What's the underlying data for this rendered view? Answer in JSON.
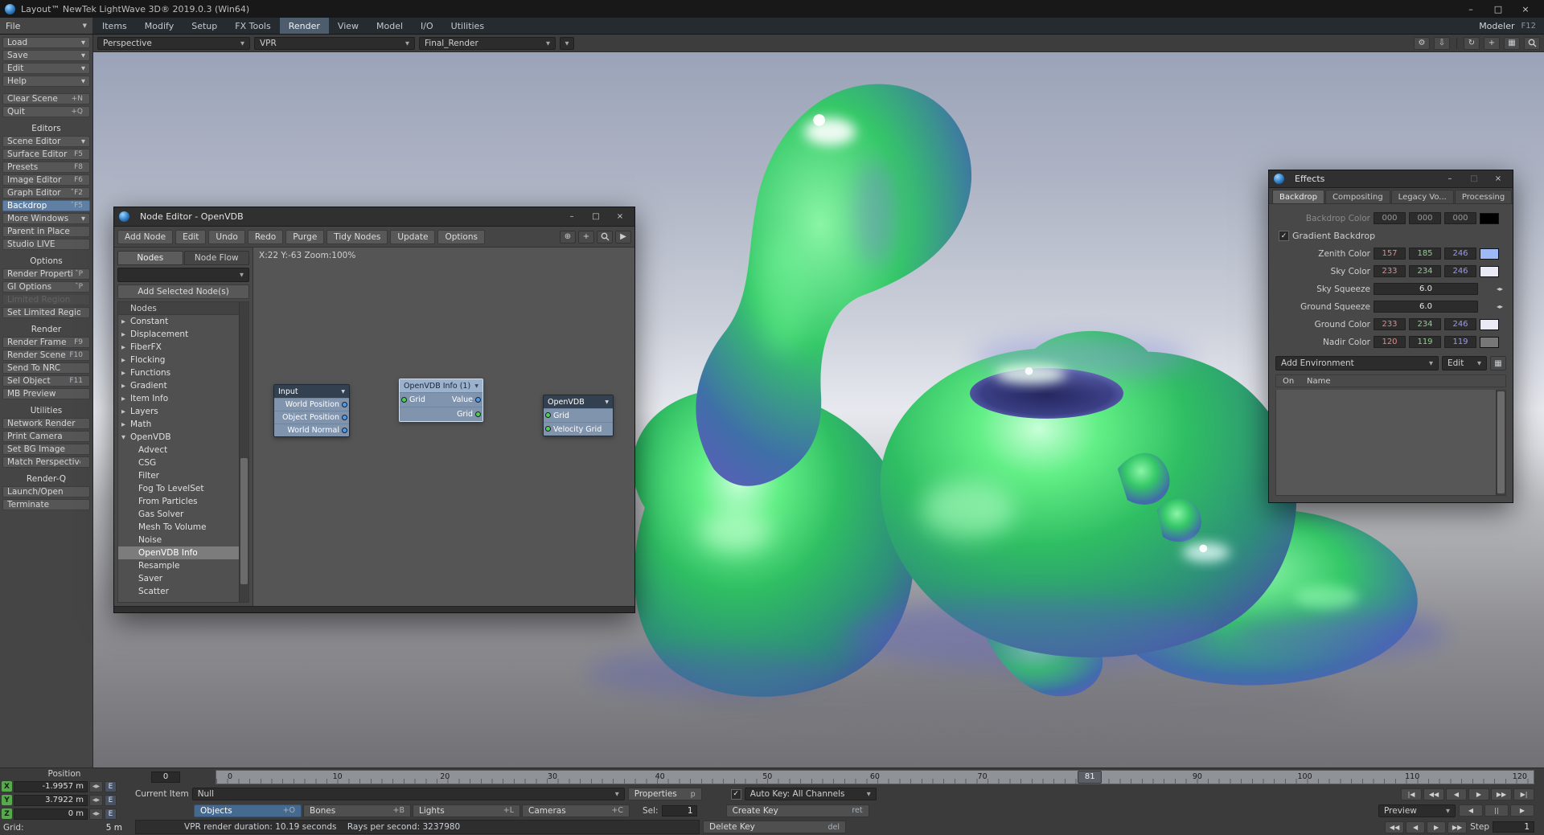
{
  "icons": {
    "chevron_down": "▼",
    "minimize": "–",
    "maximize": "□",
    "close": "×",
    "gear": "⚙",
    "download": "⇩",
    "rotate": "↻",
    "pan": "+",
    "grid": "▦",
    "pick": "⊕",
    "play": "▶",
    "check": "✓",
    "spinner": "◀▶",
    "stepper": "◂▸"
  },
  "titlebar": {
    "title": "Layout™ NewTek LightWave 3D® 2019.0.3 (Win64)"
  },
  "menubar": {
    "file": "File",
    "tabs": [
      {
        "label": "Items"
      },
      {
        "label": "Modify"
      },
      {
        "label": "Setup"
      },
      {
        "label": "FX Tools"
      },
      {
        "label": "Render",
        "state": "active"
      },
      {
        "label": "View"
      },
      {
        "label": "Model"
      },
      {
        "label": "I/O"
      },
      {
        "label": "Utilities"
      }
    ],
    "modeler": "Modeler",
    "modeler_key": "F12"
  },
  "viewport_bar": {
    "view": "Perspective",
    "renderer": "VPR",
    "camera": "Final_Render"
  },
  "sidebar": {
    "file_group": [
      {
        "label": "Load",
        "chev": "▼"
      },
      {
        "label": "Save",
        "chev": "▼"
      },
      {
        "label": "Edit",
        "chev": "▼"
      },
      {
        "label": "Help",
        "chev": "▼"
      }
    ],
    "scene_group": [
      {
        "label": "Clear Scene",
        "key": "+N"
      },
      {
        "label": "Quit",
        "key": "+Q"
      }
    ],
    "editors_title": "Editors",
    "editors_group": [
      {
        "label": "Scene Editor",
        "chev": "▼"
      },
      {
        "label": "Surface Editor",
        "key": "F5"
      },
      {
        "label": "Presets",
        "key": "F8"
      },
      {
        "label": "Image Editor",
        "key": "F6"
      },
      {
        "label": "Graph Editor",
        "key": "ˆF2"
      },
      {
        "label": "Backdrop",
        "key": "ˆF5",
        "state": "active"
      },
      {
        "label": "More Windows",
        "chev": "▼"
      },
      {
        "label": "Parent in Place"
      },
      {
        "label": "Studio LIVE"
      }
    ],
    "options_title": "Options",
    "options_group": [
      {
        "label": "Render Properties",
        "key": "ˆP"
      },
      {
        "label": "GI Options",
        "key": "ˆP"
      },
      {
        "label": "Limited Region",
        "state": "dim"
      },
      {
        "label": "Set Limited Region"
      }
    ],
    "render_title": "Render",
    "render_group": [
      {
        "label": "Render Frame",
        "key": "F9"
      },
      {
        "label": "Render Scene",
        "key": "F10"
      },
      {
        "label": "Send To NRC"
      },
      {
        "label": "Sel Object",
        "key": "F11"
      },
      {
        "label": "MB Preview"
      }
    ],
    "utilities_title": "Utilities",
    "utilities_group": [
      {
        "label": "Network Render"
      },
      {
        "label": "Print Camera"
      },
      {
        "label": "Set BG Image"
      },
      {
        "label": "Match Perspective"
      }
    ],
    "renderq_title": "Render-Q",
    "renderq_group": [
      {
        "label": "Launch/Open"
      },
      {
        "label": "Terminate"
      }
    ]
  },
  "node_editor": {
    "title": "Node Editor - OpenVDB",
    "toolbar": [
      {
        "label": "Add Node"
      },
      {
        "label": "Edit"
      },
      {
        "label": "Undo"
      },
      {
        "label": "Redo"
      },
      {
        "label": "Purge"
      },
      {
        "label": "Tidy Nodes"
      },
      {
        "label": "Update"
      },
      {
        "label": "Options"
      }
    ],
    "tabs": [
      {
        "label": "Nodes",
        "state": "active"
      },
      {
        "label": "Node Flow"
      }
    ],
    "add_selected": "Add Selected Node(s)",
    "list": [
      {
        "label": "Nodes",
        "state": "header"
      },
      {
        "label": "Constant",
        "arrow": "▶"
      },
      {
        "label": "Displacement",
        "arrow": "▶"
      },
      {
        "label": "FiberFX",
        "arrow": "▶"
      },
      {
        "label": "Flocking",
        "arrow": "▶"
      },
      {
        "label": "Functions",
        "arrow": "▶"
      },
      {
        "label": "Gradient",
        "arrow": "▶"
      },
      {
        "label": "Item Info",
        "arrow": "▶"
      },
      {
        "label": "Layers",
        "arrow": "▶"
      },
      {
        "label": "Math",
        "arrow": "▶"
      },
      {
        "label": "OpenVDB",
        "arrow": "▼"
      },
      {
        "label": "Advect",
        "child": "1"
      },
      {
        "label": "CSG",
        "child": "1"
      },
      {
        "label": "Filter",
        "child": "1"
      },
      {
        "label": "Fog To LevelSet",
        "child": "1"
      },
      {
        "label": "From Particles",
        "child": "1"
      },
      {
        "label": "Gas Solver",
        "child": "1"
      },
      {
        "label": "Mesh To Volume",
        "child": "1"
      },
      {
        "label": "Noise",
        "child": "1"
      },
      {
        "label": "OpenVDB Info",
        "child": "1",
        "state": "active"
      },
      {
        "label": "Resample",
        "child": "1"
      },
      {
        "label": "Saver",
        "child": "1"
      },
      {
        "label": "Scatter",
        "child": "1"
      }
    ],
    "graph": {
      "coords": "X:22 Y:-63 Zoom:100%",
      "input_node": {
        "title": "Input",
        "rows": [
          {
            "label": "World Position"
          },
          {
            "label": "Object Position"
          },
          {
            "label": "World Normal"
          }
        ]
      },
      "info_node": {
        "title": "OpenVDB Info (1)",
        "input": "Grid",
        "out_value": "Value",
        "out_grid": "Grid"
      },
      "vdb_node": {
        "title": "OpenVDB",
        "rows": [
          {
            "label": "Grid"
          },
          {
            "label": "Velocity Grid"
          }
        ]
      }
    }
  },
  "effects": {
    "title": "Effects",
    "tabs": [
      {
        "label": "Backdrop",
        "state": "active"
      },
      {
        "label": "Compositing"
      },
      {
        "label": "Legacy Vo..."
      },
      {
        "label": "Processing"
      }
    ],
    "rows": {
      "backdrop": {
        "label": "Backdrop Color",
        "r": "000",
        "g": "000",
        "b": "000",
        "swatch": "#000000"
      },
      "gradient": {
        "label": "Gradient Backdrop"
      },
      "zenith": {
        "label": "Zenith Color",
        "r": "157",
        "g": "185",
        "b": "246",
        "swatch": "#9db9f6"
      },
      "sky": {
        "label": "Sky Color",
        "r": "233",
        "g": "234",
        "b": "246",
        "swatch": "#e9eaf6"
      },
      "sky_squeeze": {
        "label": "Sky Squeeze",
        "value": "6.0"
      },
      "ground_squeeze": {
        "label": "Ground Squeeze",
        "value": "6.0"
      },
      "ground": {
        "label": "Ground Color",
        "r": "233",
        "g": "234",
        "b": "246",
        "swatch": "#e9eaf6"
      },
      "nadir": {
        "label": "Nadir Color",
        "r": "120",
        "g": "119",
        "b": "119",
        "swatch": "#787777"
      }
    },
    "add_environment": "Add Environment",
    "edit": "Edit",
    "list_on": "On",
    "list_name": "Name"
  },
  "viewport": {
    "sky_top": "#9aa3b8",
    "horizon": "#e7e9ef",
    "ground_bottom": "#717175"
  },
  "timeline": {
    "start": "0",
    "slots": [
      {
        "t": "0"
      },
      {
        "t": "10"
      },
      {
        "t": "20"
      },
      {
        "t": "30"
      },
      {
        "t": "40"
      },
      {
        "t": "50"
      },
      {
        "t": "60"
      },
      {
        "t": "70"
      },
      {
        "t": "81",
        "state": "handle"
      },
      {
        "t": "90"
      },
      {
        "t": "100"
      },
      {
        "t": "110"
      },
      {
        "t": "120"
      }
    ]
  },
  "bottom": {
    "position_label": "Position",
    "axes": [
      {
        "axis": "X",
        "value": "-1.9957 m"
      },
      {
        "axis": "Y",
        "value": "3.7922 m"
      },
      {
        "axis": "Z",
        "value": "0 m"
      }
    ],
    "envelope": "E",
    "grid_label": "Grid:",
    "grid_value": "5 m",
    "current_item_label": "Current Item",
    "current_item": "Null",
    "properties_label": "Properties",
    "properties_key": "p",
    "autokey_label": "Auto Key: All Channels",
    "item_types": [
      {
        "label": "Objects",
        "key": "+O",
        "state": "active"
      },
      {
        "label": "Bones",
        "key": "+B"
      },
      {
        "label": "Lights",
        "key": "+L"
      },
      {
        "label": "Cameras",
        "key": "+C"
      }
    ],
    "sel_label": "Sel:",
    "sel_value": "1",
    "create_key": {
      "label": "Create Key",
      "key": "ret"
    },
    "delete_key": {
      "label": "Delete Key",
      "key": "del"
    },
    "status": "VPR render duration: 10.19 seconds    Rays per second: 3237980",
    "transport_a": [
      "|◀",
      "◀◀",
      "◀",
      "▶",
      "▶▶",
      "▶|"
    ],
    "preview_label": "Preview",
    "transport_b": [
      "◀",
      "||",
      "▶"
    ],
    "transport_c": [
      "◀◀",
      "◀",
      "▶",
      "▶▶"
    ],
    "step_label": "Step",
    "step_value": "1"
  }
}
